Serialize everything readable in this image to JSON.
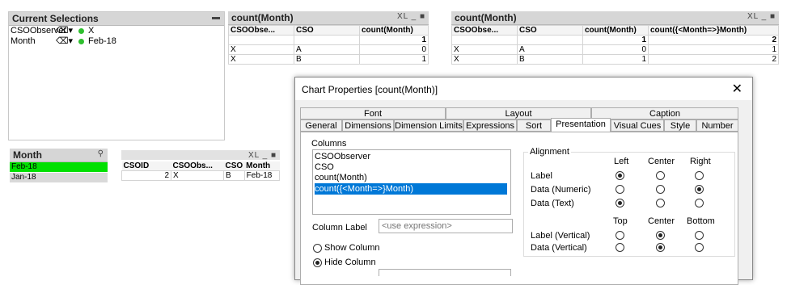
{
  "current_selections": {
    "title": "Current Selections",
    "rows": [
      {
        "field": "CSOObserver",
        "value": "X"
      },
      {
        "field": "Month",
        "value": "Feb-18"
      }
    ]
  },
  "month_listbox": {
    "title": "Month",
    "items": [
      "Feb-18",
      "Jan-18"
    ]
  },
  "table_small": {
    "headers": [
      "CSOID",
      "CSOObs...",
      "CSO",
      "Month"
    ],
    "row": [
      "2",
      "X",
      "B",
      "Feb-18"
    ]
  },
  "chart1": {
    "title": "count(Month)",
    "headers": [
      "CSOObse...",
      "CSO",
      "count(Month)"
    ],
    "total": "1",
    "rows": [
      [
        "X",
        "A",
        "0"
      ],
      [
        "X",
        "B",
        "1"
      ]
    ]
  },
  "chart2": {
    "title": "count(Month)",
    "headers": [
      "CSOObse...",
      "CSO",
      "count(Month)",
      "count({<Month=>}Month)"
    ],
    "totals": [
      "1",
      "2"
    ],
    "rows": [
      [
        "X",
        "A",
        "0",
        "1"
      ],
      [
        "X",
        "B",
        "1",
        "2"
      ]
    ]
  },
  "object_icons": "XL _ ■",
  "dialog": {
    "title": "Chart Properties [count(Month)]",
    "close": "✕",
    "tabs_top": [
      "Font",
      "Layout",
      "Caption"
    ],
    "tabs_bottom": [
      "General",
      "Dimensions",
      "Dimension Limits",
      "Expressions",
      "Sort",
      "Presentation",
      "Visual Cues",
      "Style",
      "Number"
    ],
    "columns_label": "Columns",
    "columns": [
      "CSOObserver",
      "CSO",
      "count(Month)",
      "count({<Month=>}Month)"
    ],
    "column_label_text": "Column Label",
    "column_label_placeholder": "<use expression>",
    "show_column": "Show Column",
    "hide_column": "Hide Column",
    "alignment_label": "Alignment",
    "align_headers": [
      "Left",
      "Center",
      "Right"
    ],
    "align_rows": [
      "Label",
      "Data (Numeric)",
      "Data (Text)"
    ],
    "valign_headers": [
      "Top",
      "Center",
      "Bottom"
    ],
    "valign_rows": [
      "Label (Vertical)",
      "Data (Vertical)"
    ]
  }
}
